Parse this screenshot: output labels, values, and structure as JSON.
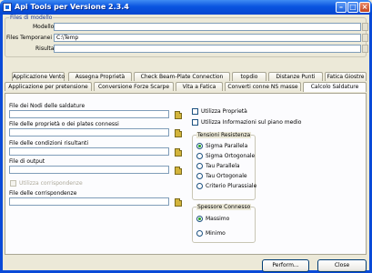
{
  "window": {
    "title": "Api Tools per Versione 2.3.4"
  },
  "top_section": {
    "group_label": "Files di modello",
    "fields": [
      {
        "label": "Modello",
        "value": ""
      },
      {
        "label": "Files Temporanei",
        "value": "C:\\Temp"
      },
      {
        "label": "Risultati",
        "value": ""
      }
    ]
  },
  "tabs_row1": [
    "Applicazione Vento",
    "Assegna Proprietà",
    "Check Beam-Plate Connection",
    "topdio",
    "Distanze Punti",
    "Fatica Giostre"
  ],
  "tabs_row2": [
    "Applicazione per pretensione",
    "Conversione Forze Scarpe",
    "Vita a Fatica",
    "Converti conne NS masse",
    "Calcolo Saldature"
  ],
  "active_tab": "Calcolo Saldature",
  "panel": {
    "files": [
      {
        "label": "File dei Nodi delle saldature",
        "value": ""
      },
      {
        "label": "File delle proprietà o dei plates connessi",
        "value": ""
      },
      {
        "label": "File delle condizioni risultanti",
        "value": ""
      },
      {
        "label": "File di output",
        "value": ""
      },
      {
        "label": "File delle corrispondenze",
        "value": ""
      }
    ],
    "use_corrispondenze_label": "Utilizza corrispondenze",
    "use_proprieta_label": "Utilizza Proprietà",
    "use_piano_medio_label": "Utilizza Informazioni sul piano medio",
    "tensioni": {
      "title": "Tensioni Resistenza",
      "options": [
        "Sigma Parallela",
        "Sigma Ortogonale",
        "Tau Parallela",
        "Tau Ortogonale",
        "Criterio Plurassiale"
      ],
      "selected": "Sigma Parallela"
    },
    "spessore": {
      "title": "Spessore Connesso",
      "options": [
        "Massimo",
        "Minimo"
      ],
      "selected": "Massimo"
    }
  },
  "buttons": {
    "perform": "Perform...",
    "close": "Close"
  }
}
